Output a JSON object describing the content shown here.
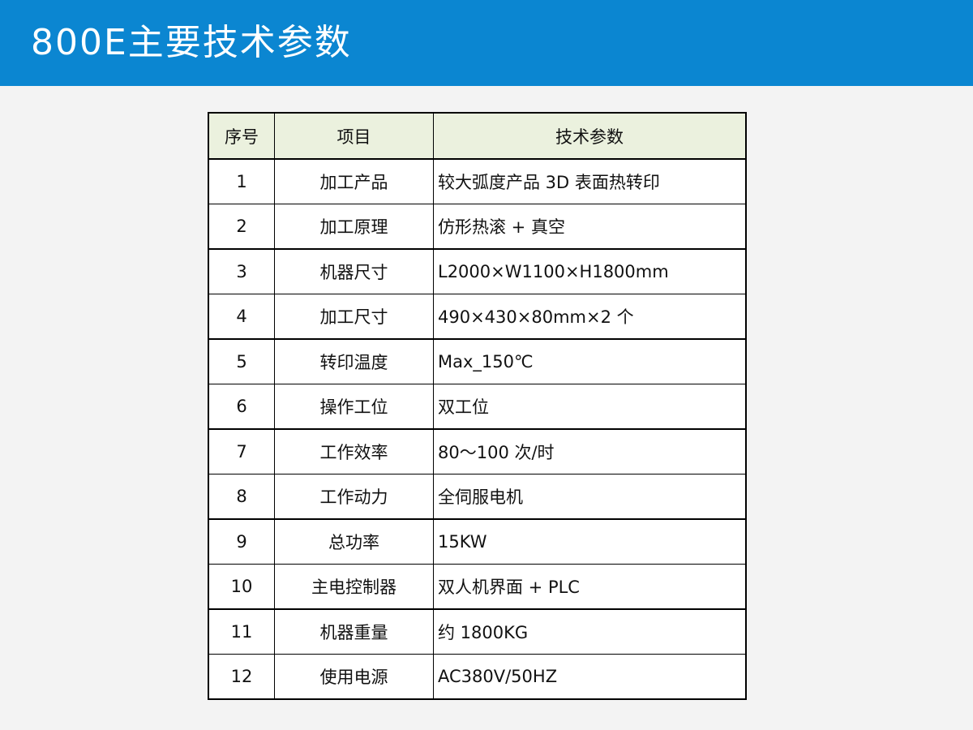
{
  "slide": {
    "title": "800E主要技术参数"
  },
  "table": {
    "headers": {
      "no": "序号",
      "item": "项目",
      "spec": "技术参数"
    },
    "rows": [
      {
        "no": "1",
        "item": "加工产品",
        "spec": "较大弧度产品 3D 表面热转印"
      },
      {
        "no": "2",
        "item": "加工原理",
        "spec": "仿形热滚 + 真空"
      },
      {
        "no": "3",
        "item": "机器尺寸",
        "spec": "L2000×W1100×H1800mm"
      },
      {
        "no": "4",
        "item": "加工尺寸",
        "spec": "490×430×80mm×2 个"
      },
      {
        "no": "5",
        "item": "转印温度",
        "spec": "Max_150℃"
      },
      {
        "no": "6",
        "item": "操作工位",
        "spec": "双工位"
      },
      {
        "no": "7",
        "item": "工作效率",
        "spec": "80～100 次/时"
      },
      {
        "no": "8",
        "item": "工作动力",
        "spec": "全伺服电机"
      },
      {
        "no": "9",
        "item": "总功率",
        "spec": "15KW"
      },
      {
        "no": "10",
        "item": "主电控制器",
        "spec": "双人机界面 + PLC"
      },
      {
        "no": "11",
        "item": "机器重量",
        "spec": "约 1800KG"
      },
      {
        "no": "12",
        "item": "使用电源",
        "spec": "AC380V/50HZ"
      }
    ]
  },
  "colors": {
    "header_bar": "#0b86d1",
    "table_header_bg": "#ebf1de",
    "page_bg": "#f3f3f3"
  }
}
